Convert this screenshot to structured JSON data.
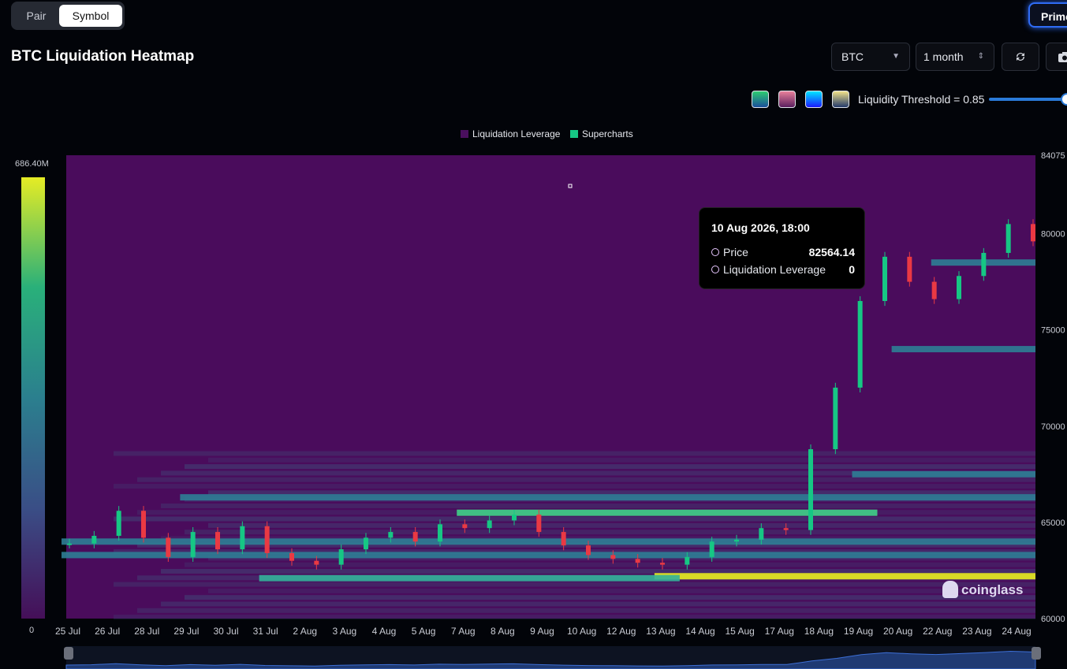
{
  "toggle": {
    "pair_label": "Pair",
    "symbol_label": "Symbol",
    "active": "Symbol"
  },
  "header": {
    "prime_label": "Prime"
  },
  "title": "BTC Liquidation Heatmap",
  "controls": {
    "coin": "BTC",
    "range": "1 month"
  },
  "palettes": [
    {
      "name": "viridis",
      "from": "#2ecc71",
      "to": "#1b4f9c"
    },
    {
      "name": "magma",
      "from": "#e8809a",
      "to": "#5a1f5e"
    },
    {
      "name": "jet",
      "from": "#00e5ff",
      "to": "#1a1aff"
    },
    {
      "name": "cividis",
      "from": "#f1e28a",
      "to": "#233a6b"
    }
  ],
  "threshold": {
    "label": "Liquidity Threshold = 0.85",
    "value": 0.85
  },
  "legend": [
    {
      "label": "Liquidation Leverage",
      "color": "#4a0f5e"
    },
    {
      "label": "Supercharts",
      "color": "#16c784"
    }
  ],
  "colorbar": {
    "max_label": "686.40M",
    "min_label": "0"
  },
  "tooltip": {
    "title": "10 Aug 2026, 18:00",
    "price_label": "Price",
    "price_value": "82564.14",
    "leverage_label": "Liquidation Leverage",
    "leverage_value": "0"
  },
  "watermark": "coinglass",
  "chart_data": {
    "type": "heatmap",
    "x_ticks": [
      "25 Jul",
      "26 Jul",
      "28 Jul",
      "29 Jul",
      "30 Jul",
      "31 Jul",
      "2 Aug",
      "3 Aug",
      "4 Aug",
      "5 Aug",
      "7 Aug",
      "8 Aug",
      "9 Aug",
      "10 Aug",
      "12 Aug",
      "13 Aug",
      "14 Aug",
      "15 Aug",
      "17 Aug",
      "18 Aug",
      "19 Aug",
      "20 Aug",
      "22 Aug",
      "23 Aug",
      "24 Aug"
    ],
    "y_ticks": [
      "84075",
      "80000",
      "75000",
      "70000",
      "65000",
      "60000"
    ],
    "ylim": [
      60000,
      84075
    ],
    "price_series": [
      63900,
      64300,
      65600,
      64200,
      63200,
      64500,
      63600,
      64800,
      63400,
      63000,
      62800,
      63600,
      64200,
      64500,
      64000,
      64900,
      64700,
      65100,
      65400,
      64500,
      63800,
      63300,
      63100,
      62900,
      62800,
      63200,
      64000,
      64100,
      64700,
      64600,
      68800,
      72000,
      76500,
      78800,
      77500,
      76600,
      77800,
      79000,
      80500,
      79600
    ],
    "liquidation_bands": [
      {
        "price": 62200,
        "x_from": "13 Aug",
        "x_to": "24 Aug",
        "intensity": 1.0
      },
      {
        "price": 62100,
        "x_from": "31 Jul",
        "x_to": "13 Aug",
        "intensity": 0.55
      },
      {
        "price": 65500,
        "x_from": "7 Aug",
        "x_to": "19 Aug",
        "intensity": 0.7
      },
      {
        "price": 64000,
        "x_from": "25 Jul",
        "x_to": "24 Aug",
        "intensity": 0.4
      },
      {
        "price": 63300,
        "x_from": "25 Jul",
        "x_to": "24 Aug",
        "intensity": 0.35
      },
      {
        "price": 66300,
        "x_from": "29 Jul",
        "x_to": "24 Aug",
        "intensity": 0.3
      },
      {
        "price": 67500,
        "x_from": "19 Aug",
        "x_to": "24 Aug",
        "intensity": 0.4
      },
      {
        "price": 74000,
        "x_from": "20 Aug",
        "x_to": "24 Aug",
        "intensity": 0.35
      },
      {
        "price": 78500,
        "x_from": "22 Aug",
        "x_to": "24 Aug",
        "intensity": 0.4
      }
    ]
  }
}
